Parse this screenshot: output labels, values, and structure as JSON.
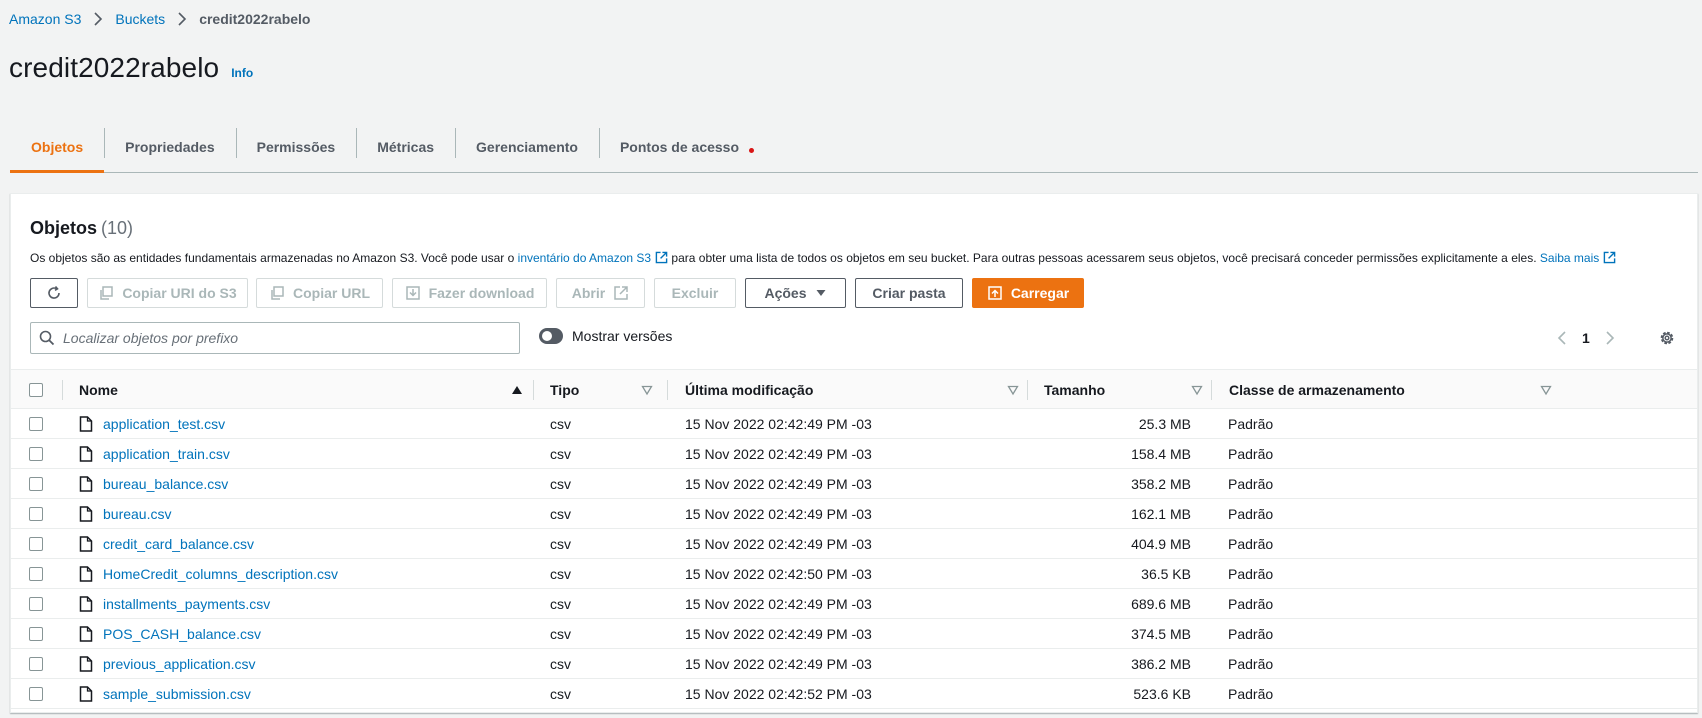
{
  "breadcrumb": {
    "items": [
      "Amazon S3",
      "Buckets"
    ],
    "current": "credit2022rabelo"
  },
  "page": {
    "title": "credit2022rabelo",
    "info": "Info"
  },
  "tabs": [
    {
      "label": "Objetos",
      "active": true
    },
    {
      "label": "Propriedades"
    },
    {
      "label": "Permissões"
    },
    {
      "label": "Métricas"
    },
    {
      "label": "Gerenciamento"
    },
    {
      "label": "Pontos de acesso",
      "dot": true
    }
  ],
  "objects": {
    "header": "Objetos",
    "count": "(10)",
    "desc_1": "Os objetos são as entidades fundamentais armazenadas no Amazon S3. Você pode usar o",
    "desc_link": "inventário do Amazon S3",
    "desc_2": "para obter uma lista de todos os objetos em seu bucket. Para outras pessoas acessarem seus objetos, você precisará conceder permissões explicitamente a eles.",
    "learn_more": "Saiba mais"
  },
  "actions": {
    "copy_uri": "Copiar URI do S3",
    "copy_url": "Copiar URL",
    "download": "Fazer download",
    "open": "Abrir",
    "delete": "Excluir",
    "actions": "Ações",
    "create_folder": "Criar pasta",
    "upload": "Carregar"
  },
  "search": {
    "placeholder": "Localizar objetos por prefixo"
  },
  "toggle": {
    "label": "Mostrar versões"
  },
  "pagination": {
    "page": "1"
  },
  "table": {
    "columns": {
      "name": "Nome",
      "type": "Tipo",
      "modified": "Última modificação",
      "size": "Tamanho",
      "storage": "Classe de armazenamento"
    },
    "rows": [
      {
        "name": "application_test.csv",
        "type": "csv",
        "modified": "15 Nov 2022 02:42:49 PM -03",
        "size": "25.3 MB",
        "storage": "Padrão"
      },
      {
        "name": "application_train.csv",
        "type": "csv",
        "modified": "15 Nov 2022 02:42:49 PM -03",
        "size": "158.4 MB",
        "storage": "Padrão"
      },
      {
        "name": "bureau_balance.csv",
        "type": "csv",
        "modified": "15 Nov 2022 02:42:49 PM -03",
        "size": "358.2 MB",
        "storage": "Padrão"
      },
      {
        "name": "bureau.csv",
        "type": "csv",
        "modified": "15 Nov 2022 02:42:49 PM -03",
        "size": "162.1 MB",
        "storage": "Padrão"
      },
      {
        "name": "credit_card_balance.csv",
        "type": "csv",
        "modified": "15 Nov 2022 02:42:49 PM -03",
        "size": "404.9 MB",
        "storage": "Padrão"
      },
      {
        "name": "HomeCredit_columns_description.csv",
        "type": "csv",
        "modified": "15 Nov 2022 02:42:50 PM -03",
        "size": "36.5 KB",
        "storage": "Padrão"
      },
      {
        "name": "installments_payments.csv",
        "type": "csv",
        "modified": "15 Nov 2022 02:42:49 PM -03",
        "size": "689.6 MB",
        "storage": "Padrão"
      },
      {
        "name": "POS_CASH_balance.csv",
        "type": "csv",
        "modified": "15 Nov 2022 02:42:49 PM -03",
        "size": "374.5 MB",
        "storage": "Padrão"
      },
      {
        "name": "previous_application.csv",
        "type": "csv",
        "modified": "15 Nov 2022 02:42:49 PM -03",
        "size": "386.2 MB",
        "storage": "Padrão"
      },
      {
        "name": "sample_submission.csv",
        "type": "csv",
        "modified": "15 Nov 2022 02:42:52 PM -03",
        "size": "523.6 KB",
        "storage": "Padrão"
      }
    ]
  },
  "colors": {
    "link": "#0073bb",
    "accent": "#ec7211",
    "dot": "#d91515",
    "text": "#16191f",
    "muted": "#545b64"
  }
}
